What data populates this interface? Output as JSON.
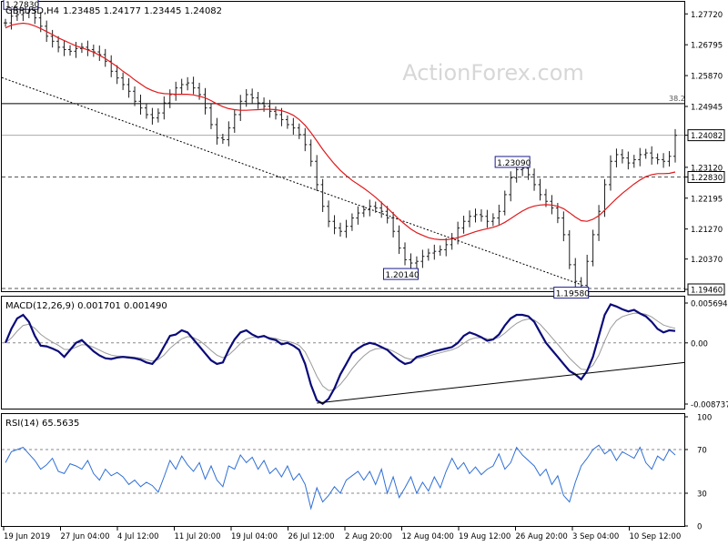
{
  "colors": {
    "price_bar": "#1c1c1c",
    "ma": "#e0191b",
    "macd_line": "#0a0a7a",
    "macd_signal": "#9a9a9a",
    "rsi": "#2f6fd6",
    "annotation_box": "#1a1a8c",
    "level_label_bg": "#ffffff",
    "grid_dash": "#555555",
    "watermark": "#d7d7d7"
  },
  "chart_data": [
    {
      "type": "ohlc",
      "title": "GBPUSD,H4",
      "ohlc_header": "1.23485 1.24177 1.23445 1.24082",
      "watermark": "ActionForex.com",
      "ylim": [
        1.1946,
        1.28
      ],
      "y_ticks": [
        "1.27720",
        "1.26795",
        "1.25870",
        "1.24945",
        "1.24082",
        "1.23120",
        "1.22830",
        "1.22195",
        "1.21270",
        "1.20370",
        "1.19460"
      ],
      "close_series": [
        1.2745,
        1.2765,
        1.277,
        1.2775,
        1.2783,
        1.276,
        1.2735,
        1.2705,
        1.269,
        1.2672,
        1.2665,
        1.266,
        1.2668,
        1.2672,
        1.2665,
        1.2658,
        1.265,
        1.263,
        1.26,
        1.258,
        1.256,
        1.254,
        1.251,
        1.249,
        1.247,
        1.246,
        1.2475,
        1.2505,
        1.253,
        1.255,
        1.256,
        1.2565,
        1.255,
        1.253,
        1.249,
        1.244,
        1.24,
        1.2395,
        1.243,
        1.247,
        1.251,
        1.253,
        1.252,
        1.2505,
        1.2495,
        1.248,
        1.247,
        1.2455,
        1.244,
        1.243,
        1.241,
        1.238,
        1.233,
        1.226,
        1.2195,
        1.215,
        1.213,
        1.212,
        1.2135,
        1.216,
        1.2175,
        1.2185,
        1.2195,
        1.219,
        1.218,
        1.216,
        1.212,
        1.207,
        1.2035,
        1.2025,
        1.203,
        1.2045,
        1.2055,
        1.206,
        1.2065,
        1.208,
        1.21,
        1.213,
        1.215,
        1.2165,
        1.217,
        1.2165,
        1.215,
        1.216,
        1.218,
        1.223,
        1.228,
        1.2305,
        1.2309,
        1.229,
        1.226,
        1.223,
        1.221,
        1.219,
        1.216,
        1.211,
        1.202,
        1.197,
        1.1958,
        1.203,
        1.211,
        1.218,
        1.226,
        1.233,
        1.235,
        1.234,
        1.2325,
        1.2335,
        1.235,
        1.2355,
        1.234,
        1.2335,
        1.233,
        1.2345,
        1.2408
      ],
      "ma_series": [
        1.273,
        1.2738,
        1.2742,
        1.2744,
        1.2742,
        1.2736,
        1.2728,
        1.2719,
        1.271,
        1.27,
        1.2692,
        1.2684,
        1.2676,
        1.267,
        1.2664,
        1.2657,
        1.2648,
        1.2638,
        1.2626,
        1.2614,
        1.26,
        1.2588,
        1.2574,
        1.2562,
        1.255,
        1.2542,
        1.2536,
        1.2533,
        1.2532,
        1.2531,
        1.2531,
        1.2531,
        1.2529,
        1.2525,
        1.252,
        1.2512,
        1.2502,
        1.2494,
        1.2488,
        1.2485,
        1.2483,
        1.2483,
        1.2484,
        1.2485,
        1.2486,
        1.2486,
        1.2485,
        1.2482,
        1.2476,
        1.2468,
        1.2455,
        1.2438,
        1.2416,
        1.2391,
        1.2366,
        1.2343,
        1.2322,
        1.2303,
        1.2287,
        1.2273,
        1.2261,
        1.2249,
        1.2236,
        1.2222,
        1.2206,
        1.219,
        1.2173,
        1.2156,
        1.2141,
        1.2127,
        1.2116,
        1.2108,
        1.2101,
        1.2097,
        1.2095,
        1.2095,
        1.2097,
        1.2101,
        1.2107,
        1.2113,
        1.2119,
        1.2124,
        1.2128,
        1.2132,
        1.2138,
        1.2147,
        1.2158,
        1.217,
        1.2181,
        1.219,
        1.2196,
        1.2199,
        1.22,
        1.2199,
        1.2195,
        1.2188,
        1.2176,
        1.2163,
        1.2152,
        1.215,
        1.2156,
        1.2167,
        1.2183,
        1.2201,
        1.2218,
        1.2234,
        1.2248,
        1.2262,
        1.2274,
        1.2284,
        1.229,
        1.2293,
        1.2293,
        1.2294,
        1.2298
      ],
      "annotations": [
        "1.27830",
        "1.23090",
        "1.20140",
        "1.19580"
      ],
      "lines": {
        "fib_label": "38.2",
        "fib_level": 1.2503,
        "support_level": 1.2283,
        "bottom_level": 1.1946,
        "current_price": 1.24082
      }
    },
    {
      "type": "line",
      "title": "MACD(12,26,9) 0.001701 0.001490",
      "ylim": [
        -0.008737,
        0.005694
      ],
      "y_ticks": [
        "0.005694",
        "0.00",
        "-0.008737"
      ],
      "macd_series": [
        0.0,
        0.002,
        0.0035,
        0.004,
        0.003,
        0.001,
        -0.0004,
        -0.0005,
        -0.0008,
        -0.0012,
        -0.002,
        -0.001,
        0.0,
        0.0004,
        -0.0004,
        -0.0012,
        -0.0018,
        -0.0022,
        -0.0023,
        -0.0021,
        -0.002,
        -0.0021,
        -0.0022,
        -0.0024,
        -0.0028,
        -0.003,
        -0.002,
        -0.0005,
        0.001,
        0.0012,
        0.0018,
        0.0015,
        0.0005,
        -0.0005,
        -0.0015,
        -0.0025,
        -0.003,
        -0.0028,
        -0.001,
        0.0005,
        0.0015,
        0.0018,
        0.0012,
        0.0008,
        0.001,
        0.0006,
        0.0004,
        -0.0002,
        0.0,
        -0.0004,
        -0.001,
        -0.003,
        -0.006,
        -0.0082,
        -0.0087,
        -0.008,
        -0.0065,
        -0.0045,
        -0.003,
        -0.0015,
        -0.0008,
        -0.0003,
        0.0,
        -0.0002,
        -0.0006,
        -0.001,
        -0.0018,
        -0.0025,
        -0.003,
        -0.0028,
        -0.002,
        -0.0018,
        -0.0015,
        -0.0012,
        -0.001,
        -0.0008,
        -0.0006,
        0.0,
        0.001,
        0.0015,
        0.0012,
        0.0008,
        0.0003,
        0.0005,
        0.0012,
        0.0025,
        0.0035,
        0.004,
        0.004,
        0.0038,
        0.003,
        0.0015,
        0.0,
        -0.001,
        -0.002,
        -0.003,
        -0.004,
        -0.0045,
        -0.0052,
        -0.004,
        -0.002,
        0.001,
        0.004,
        0.0055,
        0.0052,
        0.0048,
        0.0045,
        0.0047,
        0.0042,
        0.0038,
        0.003,
        0.002,
        0.0015,
        0.0018,
        0.0017
      ],
      "trendline": "rising support from the July low to the September low"
    },
    {
      "type": "line",
      "title": "RSI(14) 65.5635",
      "ylim": [
        0,
        100
      ],
      "y_ticks": [
        "100",
        "70",
        "30",
        "0"
      ],
      "rsi_series": [
        58,
        68,
        70,
        72,
        66,
        60,
        52,
        56,
        62,
        50,
        48,
        57,
        55,
        52,
        60,
        48,
        42,
        52,
        46,
        49,
        45,
        38,
        42,
        36,
        40,
        37,
        31,
        45,
        60,
        52,
        64,
        56,
        50,
        58,
        43,
        55,
        42,
        36,
        55,
        52,
        65,
        58,
        63,
        52,
        60,
        48,
        53,
        45,
        55,
        42,
        48,
        38,
        16,
        35,
        22,
        28,
        36,
        30,
        42,
        46,
        50,
        42,
        50,
        38,
        52,
        30,
        45,
        26,
        35,
        45,
        30,
        40,
        32,
        45,
        35,
        50,
        62,
        52,
        58,
        48,
        54,
        47,
        52,
        55,
        66,
        52,
        58,
        72,
        65,
        60,
        55,
        46,
        52,
        38,
        46,
        28,
        22,
        40,
        55,
        62,
        70,
        74,
        66,
        70,
        60,
        68,
        65,
        62,
        72,
        58,
        52,
        64,
        60,
        70,
        65
      ],
      "levels": [
        70,
        30
      ]
    }
  ],
  "x_axis": {
    "labels": [
      "19 Jun 2019",
      "27 Jun 04:00",
      "4 Jul 12:00",
      "11 Jul 20:00",
      "19 Jul 04:00",
      "26 Jul 12:00",
      "2 Aug 20:00",
      "12 Aug 04:00",
      "19 Aug 12:00",
      "26 Aug 20:00",
      "3 Sep 04:00",
      "10 Sep 12:00"
    ]
  }
}
